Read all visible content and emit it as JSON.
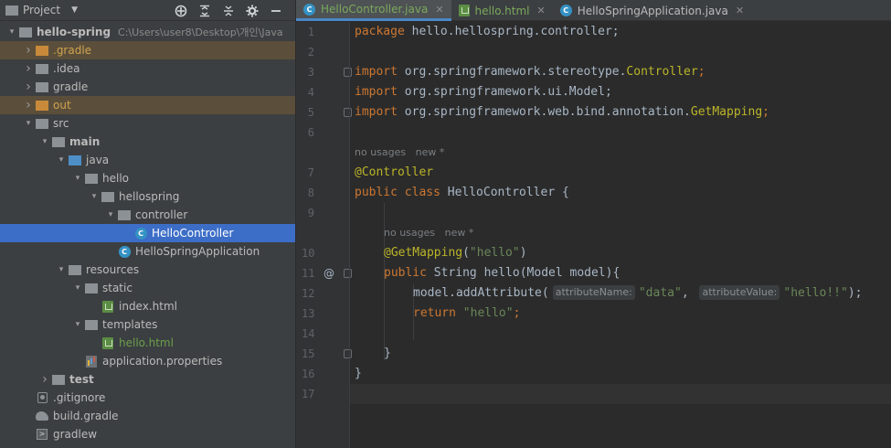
{
  "project_panel": {
    "title": "Project",
    "tools": [
      "crosshair-icon",
      "expand-all-icon",
      "collapse-all-icon",
      "gear-icon",
      "hide-icon"
    ],
    "tree": [
      {
        "label": "hello-spring",
        "path": "C:\\Users\\user8\\Desktop\\개인\\Java",
        "depth": 0,
        "expanded": true,
        "icon": "module",
        "bold": true
      },
      {
        "label": ".gradle",
        "depth": 1,
        "expanded": false,
        "icon": "folder-orange",
        "style": "excluded"
      },
      {
        "label": ".idea",
        "depth": 1,
        "expanded": false,
        "icon": "folder-grey"
      },
      {
        "label": "gradle",
        "depth": 1,
        "expanded": false,
        "icon": "folder-grey"
      },
      {
        "label": "out",
        "depth": 1,
        "expanded": false,
        "icon": "folder-orange",
        "style": "excluded"
      },
      {
        "label": "src",
        "depth": 1,
        "expanded": true,
        "icon": "folder-grey"
      },
      {
        "label": "main",
        "depth": 2,
        "expanded": true,
        "icon": "folder-grey",
        "bold": true
      },
      {
        "label": "java",
        "depth": 3,
        "expanded": true,
        "icon": "folder-blue"
      },
      {
        "label": "hello",
        "depth": 4,
        "expanded": true,
        "icon": "package"
      },
      {
        "label": "hellospring",
        "depth": 5,
        "expanded": true,
        "icon": "package"
      },
      {
        "label": "controller",
        "depth": 6,
        "expanded": true,
        "icon": "package"
      },
      {
        "label": "HelloController",
        "depth": 7,
        "leaf": true,
        "icon": "class",
        "style": "selected"
      },
      {
        "label": "HelloSpringApplication",
        "depth": 6,
        "leaf": true,
        "icon": "class-app"
      },
      {
        "label": "resources",
        "depth": 3,
        "expanded": true,
        "icon": "folder-resources"
      },
      {
        "label": "static",
        "depth": 4,
        "expanded": true,
        "icon": "folder-grey"
      },
      {
        "label": "index.html",
        "depth": 5,
        "leaf": true,
        "icon": "html"
      },
      {
        "label": "templates",
        "depth": 4,
        "expanded": true,
        "icon": "folder-grey"
      },
      {
        "label": "hello.html",
        "depth": 5,
        "leaf": true,
        "icon": "html",
        "style": "green"
      },
      {
        "label": "application.properties",
        "depth": 4,
        "leaf": true,
        "icon": "properties"
      },
      {
        "label": "test",
        "depth": 2,
        "expanded": false,
        "icon": "folder-grey",
        "bold": true
      },
      {
        "label": ".gitignore",
        "depth": 1,
        "leaf": true,
        "icon": "git"
      },
      {
        "label": "build.gradle",
        "depth": 1,
        "leaf": true,
        "icon": "gradle"
      },
      {
        "label": "gradlew",
        "depth": 1,
        "leaf": true,
        "icon": "terminal"
      }
    ]
  },
  "tabs": [
    {
      "label": "HelloController.java",
      "icon": "class",
      "active": true
    },
    {
      "label": "hello.html",
      "icon": "html",
      "active": false
    },
    {
      "label": "HelloSpringApplication.java",
      "icon": "class",
      "active": false
    }
  ],
  "editor": {
    "hints": {
      "usages": "no usages",
      "new": "new *"
    },
    "line_numbers": [
      "1",
      "2",
      "3",
      "4",
      "5",
      "6",
      "7",
      "8",
      "9",
      "10",
      "11",
      "12",
      "13",
      "14",
      "15",
      "16",
      "17"
    ],
    "gutter_marker": "@",
    "inlay_hints": {
      "attributeName": "attributeName:",
      "attributeValue": "attributeValue:"
    },
    "code": {
      "l1_kw": "package",
      "l1_rest": " hello.hellospring.controller;",
      "l3_kw": "import",
      "l3_rest": " org.springframework.stereotype.",
      "l3_cls": "Controller",
      "l3_end": ";",
      "l4_kw": "import",
      "l4_rest": " org.springframework.ui.Model;",
      "l5_kw": "import",
      "l5_rest": " org.springframework.web.bind.annotation.",
      "l5_cls": "GetMapping",
      "l5_end": ";",
      "l7_an": "@Controller",
      "l8_kw": "public class",
      "l8_rest": " HelloController {",
      "l10_an": "@GetMapping",
      "l10_open": "(",
      "l10_str": "\"hello\"",
      "l10_close": ")",
      "l11_kw": "public",
      "l11_rest": " String hello(Model model){",
      "l12_pre": "model.addAttribute(",
      "l12_s1": "\"data\"",
      "l12_comma": ", ",
      "l12_s2": "\"hello!!\"",
      "l12_end": ");",
      "l13_kw": "return",
      "l13_str": " \"hello\"",
      "l13_end": ";",
      "l15": "}",
      "l16": "}"
    }
  }
}
